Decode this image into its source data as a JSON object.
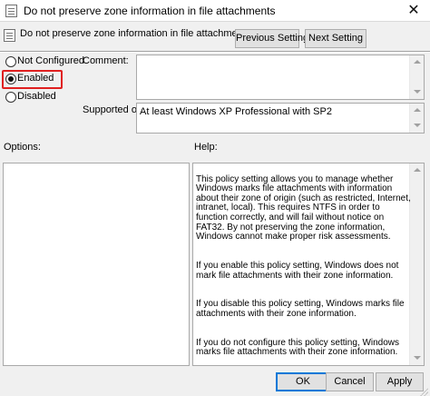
{
  "window": {
    "title": "Do not preserve zone information in file attachments",
    "close_glyph": "✕"
  },
  "header": {
    "policy_name": "Do not preserve zone information in file attachments",
    "previous_label": "Previous Setting",
    "next_label": "Next Setting"
  },
  "state": {
    "options": [
      {
        "label": "Not Configured",
        "checked": false
      },
      {
        "label": "Enabled",
        "checked": true
      },
      {
        "label": "Disabled",
        "checked": false
      }
    ]
  },
  "comment": {
    "label": "Comment:",
    "value": ""
  },
  "supported": {
    "label": "Supported on:",
    "value": "At least Windows XP Professional with SP2"
  },
  "options_pane": {
    "label": "Options:"
  },
  "help_pane": {
    "label": "Help:",
    "paragraphs": [
      "This policy setting allows you to manage whether Windows marks file attachments with information about their zone of origin (such as restricted, Internet, intranet, local). This requires NTFS in order to function correctly, and will fail without notice on FAT32. By not preserving the zone information, Windows cannot make proper risk assessments.",
      "If you enable this policy setting, Windows does not mark file attachments with their zone information.",
      "If you disable this policy setting, Windows marks file attachments with their zone information.",
      "If you do not configure this policy setting, Windows marks file attachments with their zone information."
    ]
  },
  "footer": {
    "ok_label": "OK",
    "cancel_label": "Cancel",
    "apply_label": "Apply"
  },
  "colors": {
    "highlight": "#e02020",
    "default_button_border": "#0078d7"
  }
}
